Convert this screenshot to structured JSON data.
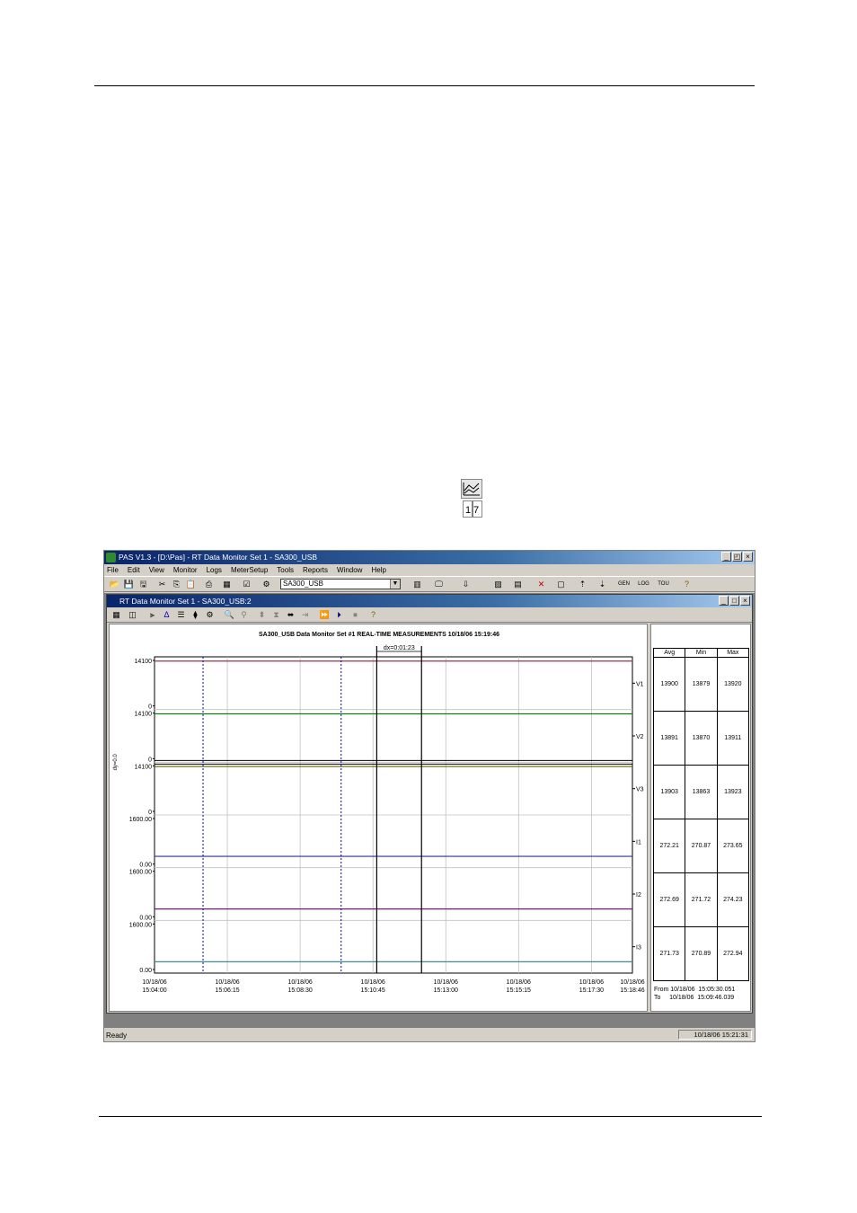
{
  "window": {
    "title": "PAS V1.3 - [D:\\Pas] - RT Data Monitor Set 1 - SA300_USB",
    "controls": [
      "_",
      "◰",
      "×"
    ]
  },
  "menu": [
    "File",
    "Edit",
    "View",
    "Monitor",
    "Logs",
    "MeterSetup",
    "Tools",
    "Reports",
    "Window",
    "Help"
  ],
  "toolbar": {
    "site_combo": "SA300_USB",
    "icons": [
      "open-icon",
      "save-icon",
      "save-all-icon",
      "cut-icon",
      "copy-icon",
      "paste-icon",
      "print-icon",
      "calendar-icon",
      "properties-icon",
      "connect-icon",
      "table-icon",
      "monitor-icon",
      "monitor-down-icon",
      "chart-icon",
      "chart2-icon",
      "delete-icon",
      "frame-icon",
      "upload-icon",
      "download-icon",
      "gen-icon",
      "log-icon",
      "tou-icon",
      "help-icon"
    ],
    "gen_label": "GEN",
    "log_label": "LOG",
    "tou_label": "TOU"
  },
  "child_window": {
    "title": "RT Data Monitor Set 1 - SA300_USB:2"
  },
  "chart_header": "SA300_USB  Data Monitor  Set #1  REAL-TIME MEASUREMENTS  10/18/06  15:19:46",
  "marker_label": "dx=0:01:23",
  "dy_label": "dy=0.0",
  "stats": {
    "headers": [
      "Avg",
      "Min",
      "Max"
    ],
    "rows": [
      [
        "13900",
        "13879",
        "13920"
      ],
      [
        "13891",
        "13870",
        "13911"
      ],
      [
        "13903",
        "13863",
        "13923"
      ],
      [
        "272.21",
        "270.87",
        "273.65"
      ],
      [
        "272.69",
        "271.72",
        "274.23"
      ],
      [
        "271.73",
        "270.89",
        "272.94"
      ]
    ],
    "from": "From 10/18/06  15:05:30.051",
    "to": "To     10/18/06  15:09:46.039"
  },
  "chart_data": {
    "type": "line",
    "x_ticks": [
      [
        "10/18/06",
        "15:04:00"
      ],
      [
        "10/18/06",
        "15:06:15"
      ],
      [
        "10/18/06",
        "15:08:30"
      ],
      [
        "10/18/06",
        "15:10:45"
      ],
      [
        "10/18/06",
        "15:13:00"
      ],
      [
        "10/18/06",
        "15:15:15"
      ],
      [
        "10/18/06",
        "15:17:30"
      ],
      [
        "10/18/06",
        "15:18:46"
      ]
    ],
    "xlim": [
      "15:04:00",
      "15:18:46"
    ],
    "panels": [
      {
        "name": "V1",
        "ylim": [
          0,
          14100
        ],
        "tick_labels": [
          "14100",
          "0"
        ],
        "value": 13900,
        "color": "#a0304a"
      },
      {
        "name": "V2",
        "ylim": [
          0,
          14100
        ],
        "tick_labels": [
          "14100",
          "0"
        ],
        "value": 13891,
        "color": "#008000"
      },
      {
        "name": "V3",
        "ylim": [
          0,
          14100
        ],
        "tick_labels": [
          "14100",
          "0"
        ],
        "value": 13903,
        "color": "#606000"
      },
      {
        "name": "I1",
        "ylim": [
          0,
          1600
        ],
        "tick_labels": [
          "1600.00",
          "0.00"
        ],
        "value": 272.21,
        "color": "#303090"
      },
      {
        "name": "I2",
        "ylim": [
          0,
          1600
        ],
        "tick_labels": [
          "1600.00",
          "0.00"
        ],
        "value": 272.69,
        "color": "#700070"
      },
      {
        "name": "I3",
        "ylim": [
          0,
          1600
        ],
        "tick_labels": [
          "1600.00",
          "0.00"
        ],
        "value": 271.73,
        "color": "#409090"
      }
    ],
    "blue_markers": [
      "15:05:30",
      "15:09:46"
    ],
    "black_markers": [
      "15:10:52",
      "15:12:15"
    ],
    "grid": true
  },
  "status": {
    "text": "Ready",
    "time": "10/18/06  15:21:31"
  }
}
